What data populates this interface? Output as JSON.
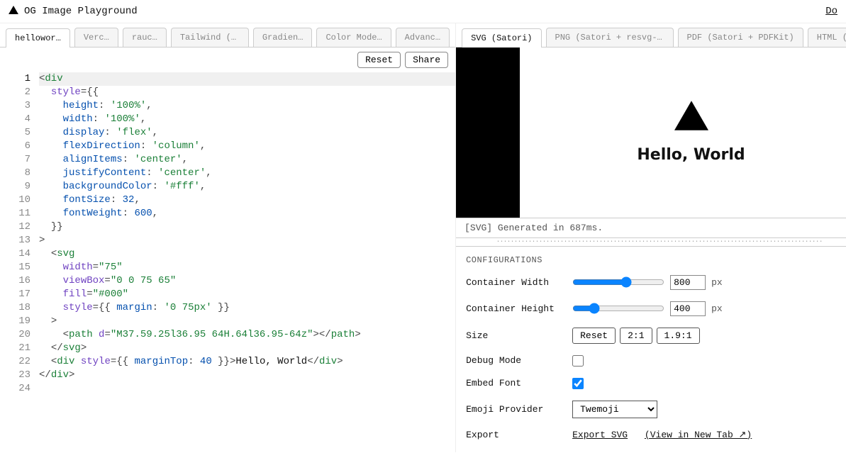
{
  "header": {
    "title": "OG Image Playground",
    "right_link": "Do"
  },
  "left_tabs": [
    "hellowor…",
    "Verc…",
    "rauc…",
    "Tailwind (experiment…",
    "Gradien…",
    "Color Mode…",
    "Advanc…"
  ],
  "left_active_tab": 0,
  "editor_buttons": {
    "reset": "Reset",
    "share": "Share"
  },
  "code": {
    "line_count": 24,
    "current_line": 1
  },
  "right_tabs": [
    "SVG (Satori)",
    "PNG (Satori + resvg-js)",
    "PDF (Satori + PDFKit)",
    "HTML ("
  ],
  "right_active_tab": 0,
  "preview": {
    "text": "Hello, World"
  },
  "status": "[SVG] Generated in 687ms.",
  "config": {
    "heading": "CONFIGURATIONS",
    "width": {
      "label": "Container Width",
      "value": 800,
      "unit": "px",
      "min": 200,
      "max": 1200
    },
    "height": {
      "label": "Container Height",
      "value": 400,
      "unit": "px",
      "min": 200,
      "max": 1200
    },
    "size": {
      "label": "Size",
      "reset": "Reset",
      "preset1": "2:1",
      "preset2": "1.9:1"
    },
    "debug": {
      "label": "Debug Mode",
      "checked": false
    },
    "embed_font": {
      "label": "Embed Font",
      "checked": true
    },
    "emoji": {
      "label": "Emoji Provider",
      "options": [
        "Twemoji"
      ],
      "selected": "Twemoji"
    },
    "export": {
      "label": "Export",
      "link_text": "Export SVG",
      "view_text": "(View in New Tab ↗)"
    }
  }
}
